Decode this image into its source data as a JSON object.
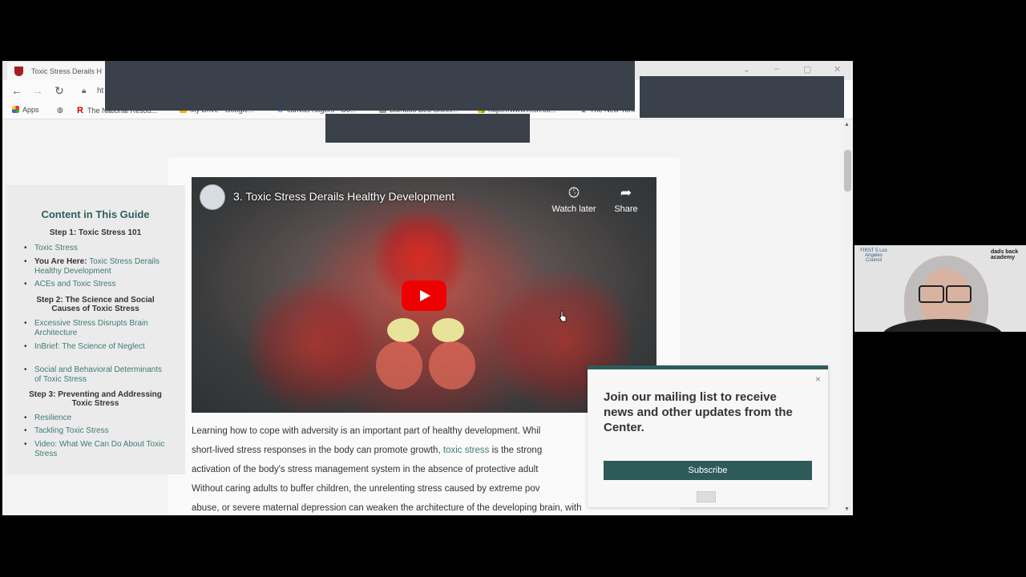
{
  "browser": {
    "tab_title": "Toxic Stress Derails H",
    "url_fragment": "ht",
    "bookmarks": [
      "Apps",
      "The National Resou...",
      "My Drive - Google...",
      "canvas rutgers - Go...",
      "Bamboo Bed Sheet...",
      "https://www.msn.co...",
      "The New York"
    ]
  },
  "sidebar": {
    "title": "Content in This Guide",
    "step1": "Step 1: Toxic Stress 101",
    "link_toxic_stress": "Toxic Stress",
    "you_are_here_prefix": "You Are Here:",
    "you_are_here_text": "Toxic Stress Derails Healthy Development",
    "link_aces": "ACEs and Toxic Stress",
    "step2": "Step 2: The Science and Social Causes of Toxic Stress",
    "link_excessive": "Excessive Stress Disrupts Brain Architecture",
    "link_inbrief": "InBrief: The Science of Neglect",
    "link_social": "Social and Behavioral Determinants of Toxic Stress",
    "step3": "Step 3: Preventing and Addressing Toxic Stress",
    "link_resilience": "Resilience",
    "link_tackling": "Tackling Toxic Stress",
    "link_video": "Video: What We Can Do About Toxic Stress"
  },
  "video": {
    "title": "3. Toxic Stress Derails Healthy Development",
    "watch_later": "Watch later",
    "share": "Share"
  },
  "article": {
    "line1": "Learning how to cope with adversity is an important part of healthy development. Whil",
    "line2_a": "short-lived stress responses in the body can promote growth, ",
    "line2_link": "toxic stress",
    "line2_b": " is the strong",
    "line3": "activation of the body's stress management system in the absence of protective adult",
    "line4": "Without caring adults to buffer children, the unrelenting stress caused by extreme pov",
    "line5": "abuse, or severe maternal depression can weaken the architecture of the developing brain, with"
  },
  "popup": {
    "message": "Join our mailing list to receive news and other updates from the Center.",
    "subscribe": "Subscribe",
    "close": "×"
  },
  "webcam": {
    "logo_left": "FIRST 5 Los Angeles Council",
    "logo_right": "dads back academy"
  },
  "colors": {
    "accent": "#2e5a5a",
    "link": "#3e7b76",
    "redaction": "#3a414b",
    "play": "#e00000"
  }
}
